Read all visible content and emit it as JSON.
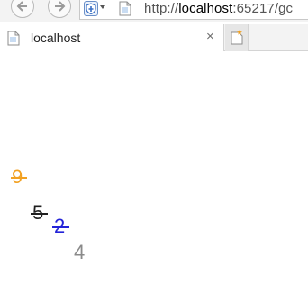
{
  "browser": {
    "url_prefix": "http://",
    "url_host": "localhost",
    "url_rest": ":65217/gc",
    "tab_title": "localhost",
    "tab_close_glyph": "×"
  },
  "icons": {
    "back": "back-arrow-icon",
    "forward": "forward-arrow-icon",
    "shield": "shield-icon",
    "page": "page-icon",
    "new_tab": "new-tab-icon"
  },
  "page": {
    "numbers": [
      {
        "value": "9",
        "color": "#f2a122",
        "struck": true
      },
      {
        "value": "5",
        "color": "#1f1f1f",
        "struck": true
      },
      {
        "value": "2",
        "color": "#2323d8",
        "struck": true
      },
      {
        "value": "4",
        "color": "#8a8a8a",
        "struck": false
      }
    ]
  }
}
